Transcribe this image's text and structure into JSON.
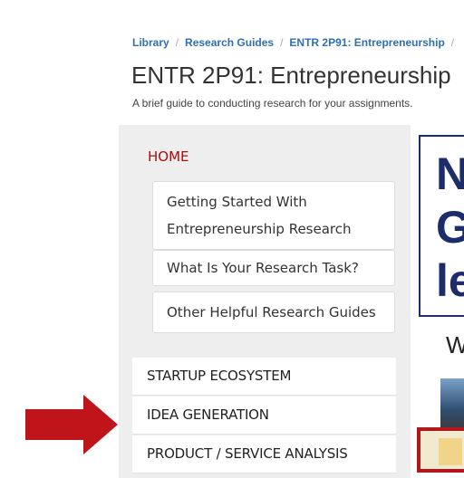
{
  "breadcrumb": {
    "items": [
      "Library",
      "Research Guides",
      "ENTR 2P91: Entrepreneurship"
    ],
    "separator": "/"
  },
  "page": {
    "title": "ENTR 2P91: Entrepreneurship",
    "subtitle": "A brief guide to conducting research for your assignments."
  },
  "nav": {
    "home": "HOME",
    "subitems": [
      "Getting Started With Entrepreneurship Research",
      "What Is Your Research Task?",
      "Other Helpful Research Guides"
    ],
    "topitems": [
      "STARTUP ECOSYSTEM",
      "IDEA GENERATION",
      "PRODUCT / SERVICE ANALYSIS"
    ]
  },
  "banner": {
    "text": "N\nG\nle"
  },
  "side_text": "W",
  "colors": {
    "link_blue": "#2f6fb4",
    "home_red": "#b10b0b",
    "banner_navy": "#1d2c6b",
    "arrow_red": "#c0141b",
    "nav_bg": "#eeeeee"
  },
  "icons": {
    "arrow": "right-arrow-icon"
  }
}
